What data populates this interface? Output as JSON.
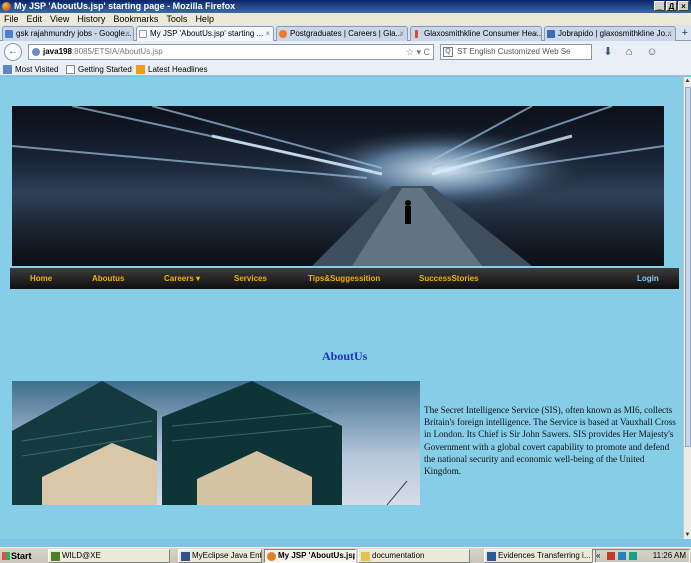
{
  "window": {
    "title": "My JSP 'AboutUs.jsp' starting page - Mozilla Firefox",
    "controls": [
      "_",
      "Д",
      "×"
    ]
  },
  "menu": [
    "File",
    "Edit",
    "View",
    "History",
    "Bookmarks",
    "Tools",
    "Help"
  ],
  "tabs": [
    {
      "label": "gsk rajahmundry jobs - Google...",
      "color": "#4a7fd6",
      "active": false
    },
    {
      "label": "My JSP 'AboutUs.jsp' starting ...",
      "color": "#ffffff",
      "active": true
    },
    {
      "label": "Postgraduates | Careers | Gla...",
      "color": "#f07a2a",
      "active": false
    },
    {
      "label": "Glaxosmithkline Consumer Hea...",
      "color": "#e5481f",
      "active": false
    },
    {
      "label": "Jobrapido | glaxosmithkline Jo...",
      "color": "#3b6bb5",
      "active": false
    }
  ],
  "tab_close": "×",
  "new_tab": "+",
  "address": {
    "host": "java198",
    "path": ":8085/ETSIA/AboutUs.jsp",
    "right_icons": "☆ ▾ C"
  },
  "search": {
    "placeholder": "ST English Customized Web Se",
    "engine_icon": "search-engine-icon"
  },
  "nav_icons": {
    "back": "←",
    "download": "⬇",
    "home": "⌂",
    "addon": "☺"
  },
  "bookmarks": [
    {
      "label": "Most Visited",
      "icon_color": "#5b87c5"
    },
    {
      "label": "Getting Started",
      "icon_color": "#ffffff"
    },
    {
      "label": "Latest Headlines",
      "icon_color": "#f39c12"
    }
  ],
  "site_nav": [
    {
      "label": "Home"
    },
    {
      "label": "Aboutus"
    },
    {
      "label": "Careers ▾"
    },
    {
      "label": "Services"
    },
    {
      "label": "Tips&Suggessition"
    },
    {
      "label": "SuccessStories"
    },
    {
      "label": "Login"
    }
  ],
  "content": {
    "heading": "AboutUs",
    "paragraph": "The Secret Intelligence Service (SIS), often known as MI6, collects Britain's foreign intelligence. The Service is based at Vauxhall Cross in London. Its Chief is Sir John Sawers. SIS provides Her Majesty's Government with a global covert capability to promote and defend the national security and economic well-being of the United Kingdom."
  },
  "taskbar": {
    "start": "Start",
    "tasks": [
      {
        "label": "WILD@XE",
        "active": false
      },
      {
        "label": "MyEclipse Java Enterpris...",
        "active": false
      },
      {
        "label": "My JSP 'AboutUs.jsp' ...",
        "active": true
      },
      {
        "label": "documentation",
        "active": false
      },
      {
        "label": "Evidences Transferring i...",
        "active": false
      }
    ],
    "tray_expand": "«",
    "clock": "11:26 AM"
  },
  "colors": {
    "page_bg": "#86cde8",
    "nav_text": "#f1b000",
    "login_text": "#7ec8ff",
    "heading": "#1d33b8"
  }
}
